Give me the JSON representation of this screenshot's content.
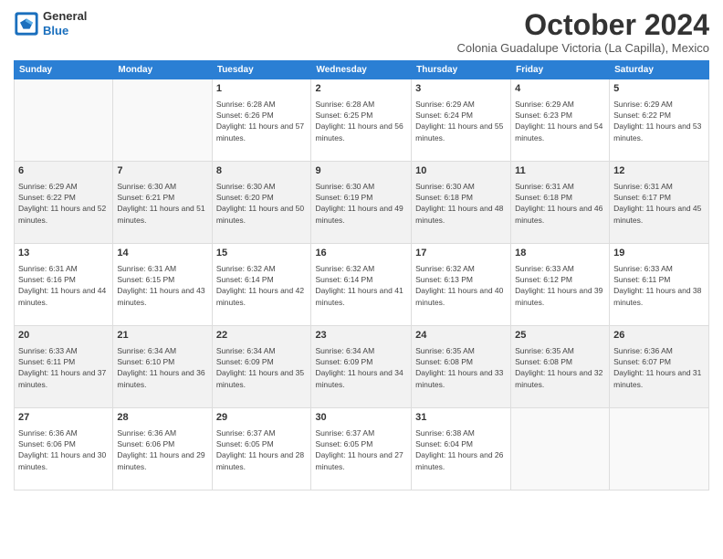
{
  "logo": {
    "general": "General",
    "blue": "Blue"
  },
  "title": "October 2024",
  "subtitle": "Colonia Guadalupe Victoria (La Capilla), Mexico",
  "days_of_week": [
    "Sunday",
    "Monday",
    "Tuesday",
    "Wednesday",
    "Thursday",
    "Friday",
    "Saturday"
  ],
  "weeks": [
    [
      {
        "day": "",
        "info": ""
      },
      {
        "day": "",
        "info": ""
      },
      {
        "day": "1",
        "info": "Sunrise: 6:28 AM\nSunset: 6:26 PM\nDaylight: 11 hours and 57 minutes."
      },
      {
        "day": "2",
        "info": "Sunrise: 6:28 AM\nSunset: 6:25 PM\nDaylight: 11 hours and 56 minutes."
      },
      {
        "day": "3",
        "info": "Sunrise: 6:29 AM\nSunset: 6:24 PM\nDaylight: 11 hours and 55 minutes."
      },
      {
        "day": "4",
        "info": "Sunrise: 6:29 AM\nSunset: 6:23 PM\nDaylight: 11 hours and 54 minutes."
      },
      {
        "day": "5",
        "info": "Sunrise: 6:29 AM\nSunset: 6:22 PM\nDaylight: 11 hours and 53 minutes."
      }
    ],
    [
      {
        "day": "6",
        "info": "Sunrise: 6:29 AM\nSunset: 6:22 PM\nDaylight: 11 hours and 52 minutes."
      },
      {
        "day": "7",
        "info": "Sunrise: 6:30 AM\nSunset: 6:21 PM\nDaylight: 11 hours and 51 minutes."
      },
      {
        "day": "8",
        "info": "Sunrise: 6:30 AM\nSunset: 6:20 PM\nDaylight: 11 hours and 50 minutes."
      },
      {
        "day": "9",
        "info": "Sunrise: 6:30 AM\nSunset: 6:19 PM\nDaylight: 11 hours and 49 minutes."
      },
      {
        "day": "10",
        "info": "Sunrise: 6:30 AM\nSunset: 6:18 PM\nDaylight: 11 hours and 48 minutes."
      },
      {
        "day": "11",
        "info": "Sunrise: 6:31 AM\nSunset: 6:18 PM\nDaylight: 11 hours and 46 minutes."
      },
      {
        "day": "12",
        "info": "Sunrise: 6:31 AM\nSunset: 6:17 PM\nDaylight: 11 hours and 45 minutes."
      }
    ],
    [
      {
        "day": "13",
        "info": "Sunrise: 6:31 AM\nSunset: 6:16 PM\nDaylight: 11 hours and 44 minutes."
      },
      {
        "day": "14",
        "info": "Sunrise: 6:31 AM\nSunset: 6:15 PM\nDaylight: 11 hours and 43 minutes."
      },
      {
        "day": "15",
        "info": "Sunrise: 6:32 AM\nSunset: 6:14 PM\nDaylight: 11 hours and 42 minutes."
      },
      {
        "day": "16",
        "info": "Sunrise: 6:32 AM\nSunset: 6:14 PM\nDaylight: 11 hours and 41 minutes."
      },
      {
        "day": "17",
        "info": "Sunrise: 6:32 AM\nSunset: 6:13 PM\nDaylight: 11 hours and 40 minutes."
      },
      {
        "day": "18",
        "info": "Sunrise: 6:33 AM\nSunset: 6:12 PM\nDaylight: 11 hours and 39 minutes."
      },
      {
        "day": "19",
        "info": "Sunrise: 6:33 AM\nSunset: 6:11 PM\nDaylight: 11 hours and 38 minutes."
      }
    ],
    [
      {
        "day": "20",
        "info": "Sunrise: 6:33 AM\nSunset: 6:11 PM\nDaylight: 11 hours and 37 minutes."
      },
      {
        "day": "21",
        "info": "Sunrise: 6:34 AM\nSunset: 6:10 PM\nDaylight: 11 hours and 36 minutes."
      },
      {
        "day": "22",
        "info": "Sunrise: 6:34 AM\nSunset: 6:09 PM\nDaylight: 11 hours and 35 minutes."
      },
      {
        "day": "23",
        "info": "Sunrise: 6:34 AM\nSunset: 6:09 PM\nDaylight: 11 hours and 34 minutes."
      },
      {
        "day": "24",
        "info": "Sunrise: 6:35 AM\nSunset: 6:08 PM\nDaylight: 11 hours and 33 minutes."
      },
      {
        "day": "25",
        "info": "Sunrise: 6:35 AM\nSunset: 6:08 PM\nDaylight: 11 hours and 32 minutes."
      },
      {
        "day": "26",
        "info": "Sunrise: 6:36 AM\nSunset: 6:07 PM\nDaylight: 11 hours and 31 minutes."
      }
    ],
    [
      {
        "day": "27",
        "info": "Sunrise: 6:36 AM\nSunset: 6:06 PM\nDaylight: 11 hours and 30 minutes."
      },
      {
        "day": "28",
        "info": "Sunrise: 6:36 AM\nSunset: 6:06 PM\nDaylight: 11 hours and 29 minutes."
      },
      {
        "day": "29",
        "info": "Sunrise: 6:37 AM\nSunset: 6:05 PM\nDaylight: 11 hours and 28 minutes."
      },
      {
        "day": "30",
        "info": "Sunrise: 6:37 AM\nSunset: 6:05 PM\nDaylight: 11 hours and 27 minutes."
      },
      {
        "day": "31",
        "info": "Sunrise: 6:38 AM\nSunset: 6:04 PM\nDaylight: 11 hours and 26 minutes."
      },
      {
        "day": "",
        "info": ""
      },
      {
        "day": "",
        "info": ""
      }
    ]
  ]
}
